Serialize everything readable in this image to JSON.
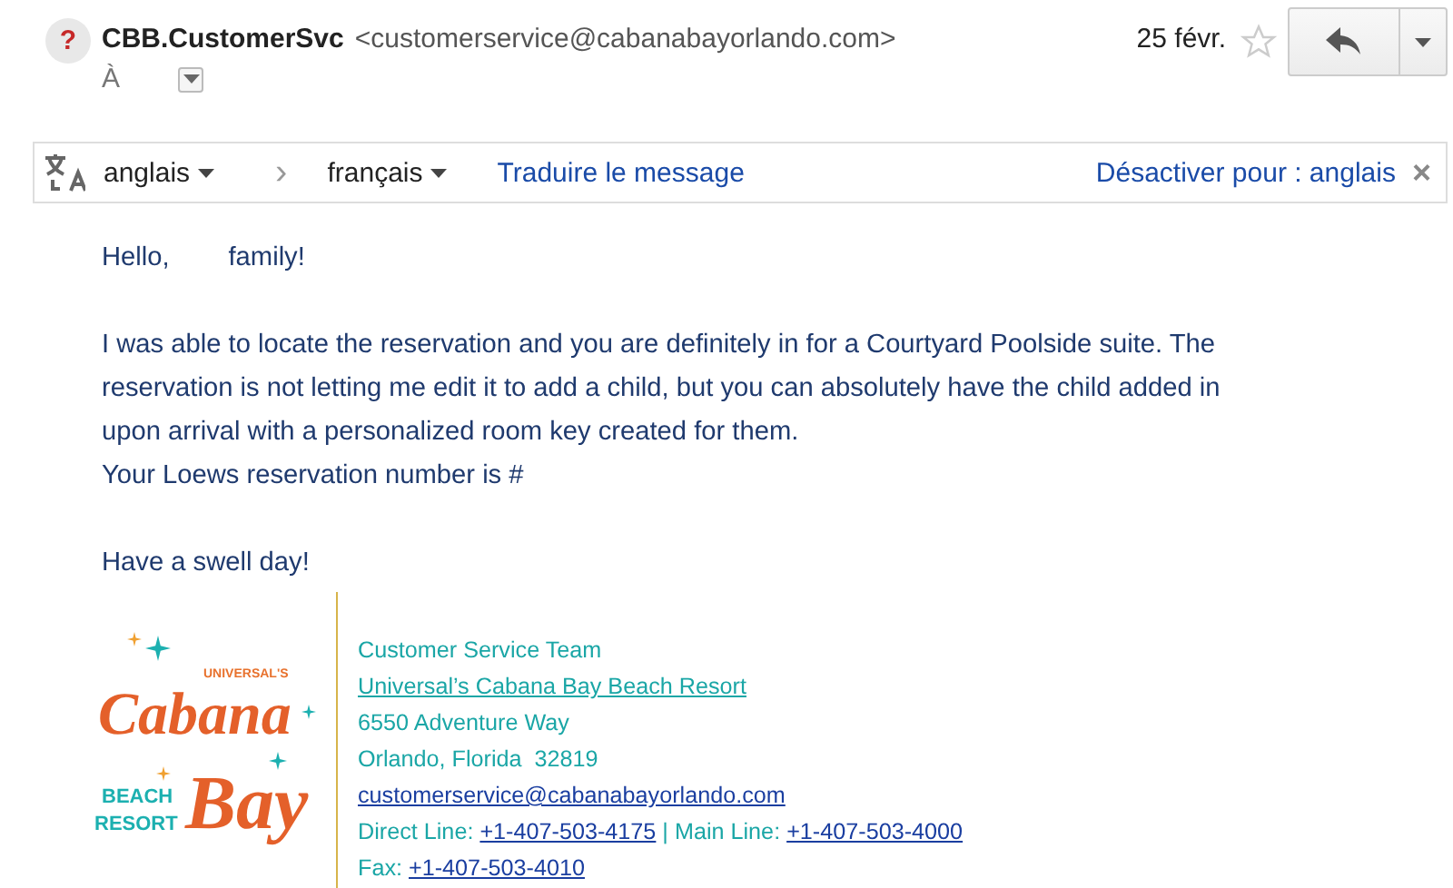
{
  "header": {
    "sender_name": "CBB.CustomerSvc",
    "sender_email": "<customerservice@cabanabayorlando.com>",
    "to_label": "À",
    "date": "25 févr.",
    "avatar_glyph": "?"
  },
  "translate_bar": {
    "source_language": "anglais",
    "separator": "›",
    "target_language": "français",
    "translate_link": "Traduire le message",
    "disable_link": "Désactiver pour : anglais",
    "close_glyph": "×"
  },
  "body": {
    "paragraphs": [
      {
        "lines": [
          "Hello,        family!"
        ]
      },
      {
        "lines": [
          "I was able to locate the reservation and you are definitely in for a Courtyard Poolside suite. The",
          "reservation is not letting me edit it to add a child, but you can absolutely have the child added in",
          "upon arrival with a personalized room key created for them.",
          "Your Loews reservation number is #"
        ]
      },
      {
        "lines": [
          "Have a swell day!"
        ]
      }
    ]
  },
  "logo": {
    "top": "UNIVERSAL'S",
    "script_1": "Cabana",
    "block_1": "BEACH",
    "block_2": "RESORT",
    "script_2": "Bay"
  },
  "signature": [
    [
      {
        "kind": "text",
        "text": "Customer Service Team"
      }
    ],
    [
      {
        "kind": "teal_link",
        "text": "Universal’s Cabana Bay Beach Resort"
      }
    ],
    [
      {
        "kind": "text",
        "text": "6550 Adventure Way"
      }
    ],
    [
      {
        "kind": "text",
        "text": "Orlando, Florida  32819"
      }
    ],
    [
      {
        "kind": "link",
        "text": "customerservice@cabanabayorlando.com"
      }
    ],
    [
      {
        "kind": "text",
        "text": "Direct Line: "
      },
      {
        "kind": "link",
        "text": "+1-407-503-4175"
      },
      {
        "kind": "text",
        "text": " | Main Line: "
      },
      {
        "kind": "link",
        "text": "+1-407-503-4000"
      }
    ],
    [
      {
        "kind": "text",
        "text": "Fax: "
      },
      {
        "kind": "link",
        "text": "+1-407-503-4010"
      }
    ]
  ]
}
